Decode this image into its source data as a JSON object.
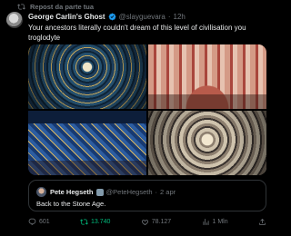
{
  "repost": {
    "icon": "repost-icon",
    "label": "Repost da parte tua"
  },
  "author": {
    "name": "George Carlin's Ghost",
    "handle": "@slayguevara",
    "separator": "·",
    "time": "12h",
    "verified_color": "#1d9bf0"
  },
  "post": {
    "text": "Your ancestors literally couldn't dream of this level of civilisation you troglodyte"
  },
  "media": [
    {
      "name": "mosque-dome-ceiling-blue"
    },
    {
      "name": "pink-mosque-interior"
    },
    {
      "name": "blue-tiled-courtyard"
    },
    {
      "name": "ornate-dome-ceiling-beige"
    }
  ],
  "quoted": {
    "name": "Pete Hegseth",
    "handle": "@PeteHegseth",
    "separator": "·",
    "time": "2 apr",
    "text": "Back to the Stone Age."
  },
  "actions": {
    "replies": "601",
    "reposts": "13.740",
    "likes": "78.127",
    "views": "1 Mln",
    "repost_color": "#00ba7c"
  },
  "colors": {
    "background": "#000000",
    "text": "#e7e9ea",
    "muted": "#71767b",
    "border": "#2f3336"
  }
}
